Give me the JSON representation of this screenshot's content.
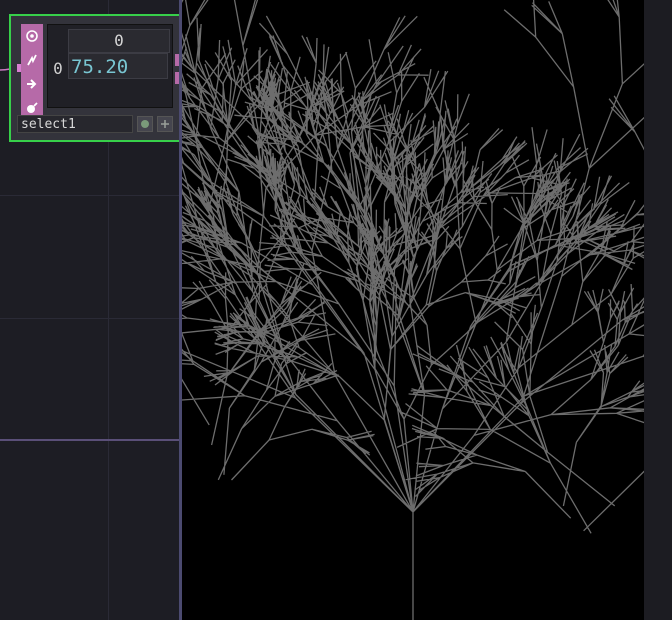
{
  "node": {
    "name": "select1",
    "viewer": {
      "header": "0",
      "row_index": "0",
      "value": "75.20"
    },
    "flags": [
      "cook-flag-icon",
      "bypass-flag-icon",
      "display-flag-icon",
      "viewer-flag-icon"
    ]
  },
  "colors": {
    "network_bg": "#1d1d24",
    "node_border_selected": "#37d04a",
    "node_family_color": "#b66aa8",
    "value_text": "#79c6d2",
    "render_bg": "#000000",
    "branch_color": "#808080"
  },
  "render": {
    "content": "fractal branching structure (grey lines on black)"
  }
}
